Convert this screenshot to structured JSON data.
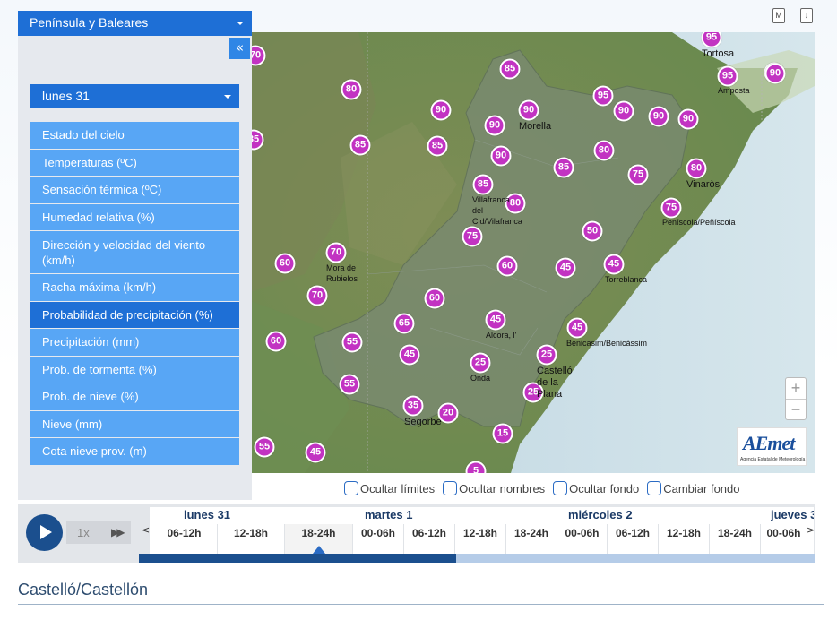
{
  "region_select": "Península y Baleares",
  "collapse_icon": "«",
  "day_select": "lunes 31",
  "menu": [
    "Estado del cielo",
    "Temperaturas (ºC)",
    "Sensación térmica (ºC)",
    "Humedad relativa (%)",
    "Dirección y velocidad del viento (km/h)",
    "Racha máxima (km/h)",
    "Probabilidad de precipitación (%)",
    "Precipitación (mm)",
    "Prob. de tormenta (%)",
    "Prob. de nieve (%)",
    "Nieve (mm)",
    "Cota nieve prov. (m)"
  ],
  "active_menu_index": 6,
  "top_icons": {
    "m_label": "M",
    "download_label": "↓"
  },
  "map": {
    "markers": [
      "70",
      "95",
      "85",
      "80",
      "90",
      "90",
      "90",
      "95",
      "90",
      "90",
      "90",
      "95",
      "90",
      "85",
      "85",
      "85",
      "90",
      "80",
      "85",
      "75",
      "80",
      "85",
      "80",
      "75",
      "75",
      "70",
      "60",
      "50",
      "60",
      "70",
      "45",
      "45",
      "60",
      "65",
      "60",
      "55",
      "45",
      "45",
      "45",
      "25",
      "25",
      "55",
      "25",
      "35",
      "20",
      "15",
      "55",
      "45",
      "5",
      "90"
    ],
    "places": {
      "tortosa": "Tortosa",
      "amposta": "Amposta",
      "morella": "Morella",
      "vinaros": "Vinaròs",
      "villafranca": "Villafranca\ndel\nCid/Vilafranca",
      "peniscola": "Peníscola/Peñíscola",
      "mora": "Mora de\nRubielos",
      "torreblanca": "Torreblanca",
      "alcora": "Alcora, l'",
      "benicasim": "Benicasim/Benicàssim",
      "onda": "Onda",
      "castello": "Castelló\nde la\nPlana",
      "segorbe": "Segorbe"
    },
    "zoom_in": "+",
    "zoom_out": "−",
    "logo_text": "AEmet",
    "logo_subtitle": "Agencia Estatal de Meteorología"
  },
  "checkboxes": [
    "Ocultar límites",
    "Ocultar nombres",
    "Ocultar fondo",
    "Cambiar fondo"
  ],
  "timeline": {
    "speed": "1x",
    "days": [
      "lunes 31",
      "martes 1",
      "miércoles 2",
      "jueves 3"
    ],
    "hours": [
      "06-12h",
      "12-18h",
      "18-24h",
      "00-06h",
      "06-12h",
      "12-18h",
      "18-24h",
      "00-06h",
      "06-12h",
      "12-18h",
      "18-24h",
      "00-06h"
    ],
    "selected_hour_index": 2,
    "prev": "<",
    "next": ">",
    "progress": 0.47
  },
  "location_title": "Castelló/Castellón"
}
